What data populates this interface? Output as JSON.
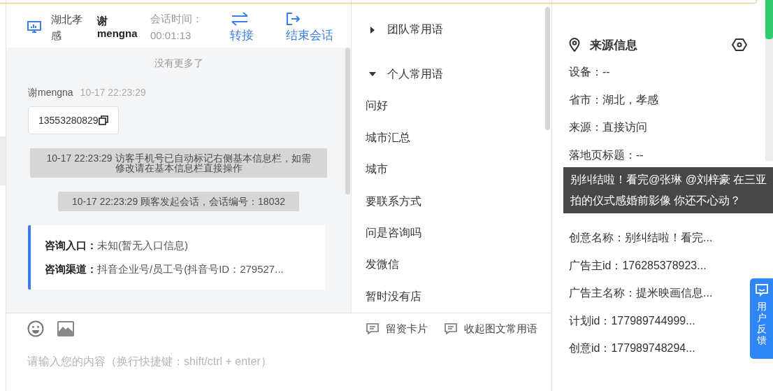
{
  "header": {
    "location": "湖北孝感",
    "agent": "谢mengna",
    "duration_label": "会话时间：",
    "duration": "00:01:13",
    "actions": [
      {
        "kind": "transfer",
        "label": "转接"
      },
      {
        "kind": "end",
        "label": "结束会话"
      }
    ]
  },
  "chat": {
    "no_more": "没有更多了",
    "messages": [
      {
        "kind": "user",
        "sender": "谢mengna",
        "time": "10-17 22:23:29",
        "text": "13553280829"
      },
      {
        "kind": "system",
        "text": "10-17 22:23:29 访客手机号已自动标记右侧基本信息栏，如需修改请在基本信息栏直接操作"
      },
      {
        "kind": "system",
        "text": "10-17 22:23:29 顾客发起会话，会话编号：18032"
      },
      {
        "kind": "info",
        "rows": [
          {
            "label": "咨询入口：",
            "value": "未知(暂无入口信息)"
          },
          {
            "label": "咨询渠道：",
            "value": "抖音企业号/员工号(抖音号ID：279527..."
          }
        ]
      }
    ]
  },
  "phrases": {
    "groups": [
      {
        "title": "团队常用语",
        "expanded": false
      },
      {
        "title": "个人常用语",
        "expanded": true,
        "items": [
          "问好",
          "城市汇总",
          "城市",
          "要联系方式",
          "问是咨询吗",
          "发微信",
          "暂时没有店"
        ]
      }
    ]
  },
  "input": {
    "placeholder": "请输入您的内容（换行快捷键：shift/ctrl + enter）",
    "tools": [
      "留资卡片",
      "收起图文常用语"
    ]
  },
  "source": {
    "title": "来源信息",
    "rows": [
      {
        "kind": "field",
        "text": "设备：--"
      },
      {
        "kind": "field",
        "text": "省市：湖北，孝感"
      },
      {
        "kind": "field",
        "text": "来源：直接访问"
      },
      {
        "kind": "field",
        "text": "落地页标题：--"
      },
      {
        "kind": "tooltip",
        "text": "别纠结啦！看完@张琳 @刘梓豪 在三亚拍的仪式感婚前影像 你还不心动？"
      },
      {
        "kind": "field",
        "text": "创意名称：别纠结啦！看完..."
      },
      {
        "kind": "field",
        "text": "广告主id：176285378923..."
      },
      {
        "kind": "field",
        "text": "广告主名称：提米映画信息..."
      },
      {
        "kind": "field",
        "text": "计划id：177989744999..."
      },
      {
        "kind": "field",
        "text": "创意id：177989748294..."
      }
    ]
  },
  "feedback": {
    "label": "用户反馈"
  }
}
